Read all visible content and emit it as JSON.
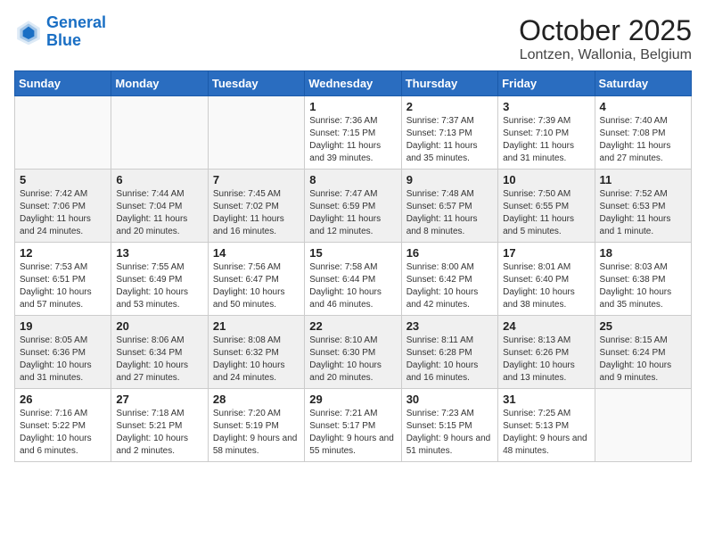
{
  "header": {
    "logo_line1": "General",
    "logo_line2": "Blue",
    "title": "October 2025",
    "subtitle": "Lontzen, Wallonia, Belgium"
  },
  "weekdays": [
    "Sunday",
    "Monday",
    "Tuesday",
    "Wednesday",
    "Thursday",
    "Friday",
    "Saturday"
  ],
  "weeks": [
    [
      {
        "day": "",
        "text": ""
      },
      {
        "day": "",
        "text": ""
      },
      {
        "day": "",
        "text": ""
      },
      {
        "day": "1",
        "text": "Sunrise: 7:36 AM\nSunset: 7:15 PM\nDaylight: 11 hours and 39 minutes."
      },
      {
        "day": "2",
        "text": "Sunrise: 7:37 AM\nSunset: 7:13 PM\nDaylight: 11 hours and 35 minutes."
      },
      {
        "day": "3",
        "text": "Sunrise: 7:39 AM\nSunset: 7:10 PM\nDaylight: 11 hours and 31 minutes."
      },
      {
        "day": "4",
        "text": "Sunrise: 7:40 AM\nSunset: 7:08 PM\nDaylight: 11 hours and 27 minutes."
      }
    ],
    [
      {
        "day": "5",
        "text": "Sunrise: 7:42 AM\nSunset: 7:06 PM\nDaylight: 11 hours and 24 minutes."
      },
      {
        "day": "6",
        "text": "Sunrise: 7:44 AM\nSunset: 7:04 PM\nDaylight: 11 hours and 20 minutes."
      },
      {
        "day": "7",
        "text": "Sunrise: 7:45 AM\nSunset: 7:02 PM\nDaylight: 11 hours and 16 minutes."
      },
      {
        "day": "8",
        "text": "Sunrise: 7:47 AM\nSunset: 6:59 PM\nDaylight: 11 hours and 12 minutes."
      },
      {
        "day": "9",
        "text": "Sunrise: 7:48 AM\nSunset: 6:57 PM\nDaylight: 11 hours and 8 minutes."
      },
      {
        "day": "10",
        "text": "Sunrise: 7:50 AM\nSunset: 6:55 PM\nDaylight: 11 hours and 5 minutes."
      },
      {
        "day": "11",
        "text": "Sunrise: 7:52 AM\nSunset: 6:53 PM\nDaylight: 11 hours and 1 minute."
      }
    ],
    [
      {
        "day": "12",
        "text": "Sunrise: 7:53 AM\nSunset: 6:51 PM\nDaylight: 10 hours and 57 minutes."
      },
      {
        "day": "13",
        "text": "Sunrise: 7:55 AM\nSunset: 6:49 PM\nDaylight: 10 hours and 53 minutes."
      },
      {
        "day": "14",
        "text": "Sunrise: 7:56 AM\nSunset: 6:47 PM\nDaylight: 10 hours and 50 minutes."
      },
      {
        "day": "15",
        "text": "Sunrise: 7:58 AM\nSunset: 6:44 PM\nDaylight: 10 hours and 46 minutes."
      },
      {
        "day": "16",
        "text": "Sunrise: 8:00 AM\nSunset: 6:42 PM\nDaylight: 10 hours and 42 minutes."
      },
      {
        "day": "17",
        "text": "Sunrise: 8:01 AM\nSunset: 6:40 PM\nDaylight: 10 hours and 38 minutes."
      },
      {
        "day": "18",
        "text": "Sunrise: 8:03 AM\nSunset: 6:38 PM\nDaylight: 10 hours and 35 minutes."
      }
    ],
    [
      {
        "day": "19",
        "text": "Sunrise: 8:05 AM\nSunset: 6:36 PM\nDaylight: 10 hours and 31 minutes."
      },
      {
        "day": "20",
        "text": "Sunrise: 8:06 AM\nSunset: 6:34 PM\nDaylight: 10 hours and 27 minutes."
      },
      {
        "day": "21",
        "text": "Sunrise: 8:08 AM\nSunset: 6:32 PM\nDaylight: 10 hours and 24 minutes."
      },
      {
        "day": "22",
        "text": "Sunrise: 8:10 AM\nSunset: 6:30 PM\nDaylight: 10 hours and 20 minutes."
      },
      {
        "day": "23",
        "text": "Sunrise: 8:11 AM\nSunset: 6:28 PM\nDaylight: 10 hours and 16 minutes."
      },
      {
        "day": "24",
        "text": "Sunrise: 8:13 AM\nSunset: 6:26 PM\nDaylight: 10 hours and 13 minutes."
      },
      {
        "day": "25",
        "text": "Sunrise: 8:15 AM\nSunset: 6:24 PM\nDaylight: 10 hours and 9 minutes."
      }
    ],
    [
      {
        "day": "26",
        "text": "Sunrise: 7:16 AM\nSunset: 5:22 PM\nDaylight: 10 hours and 6 minutes."
      },
      {
        "day": "27",
        "text": "Sunrise: 7:18 AM\nSunset: 5:21 PM\nDaylight: 10 hours and 2 minutes."
      },
      {
        "day": "28",
        "text": "Sunrise: 7:20 AM\nSunset: 5:19 PM\nDaylight: 9 hours and 58 minutes."
      },
      {
        "day": "29",
        "text": "Sunrise: 7:21 AM\nSunset: 5:17 PM\nDaylight: 9 hours and 55 minutes."
      },
      {
        "day": "30",
        "text": "Sunrise: 7:23 AM\nSunset: 5:15 PM\nDaylight: 9 hours and 51 minutes."
      },
      {
        "day": "31",
        "text": "Sunrise: 7:25 AM\nSunset: 5:13 PM\nDaylight: 9 hours and 48 minutes."
      },
      {
        "day": "",
        "text": ""
      }
    ]
  ]
}
